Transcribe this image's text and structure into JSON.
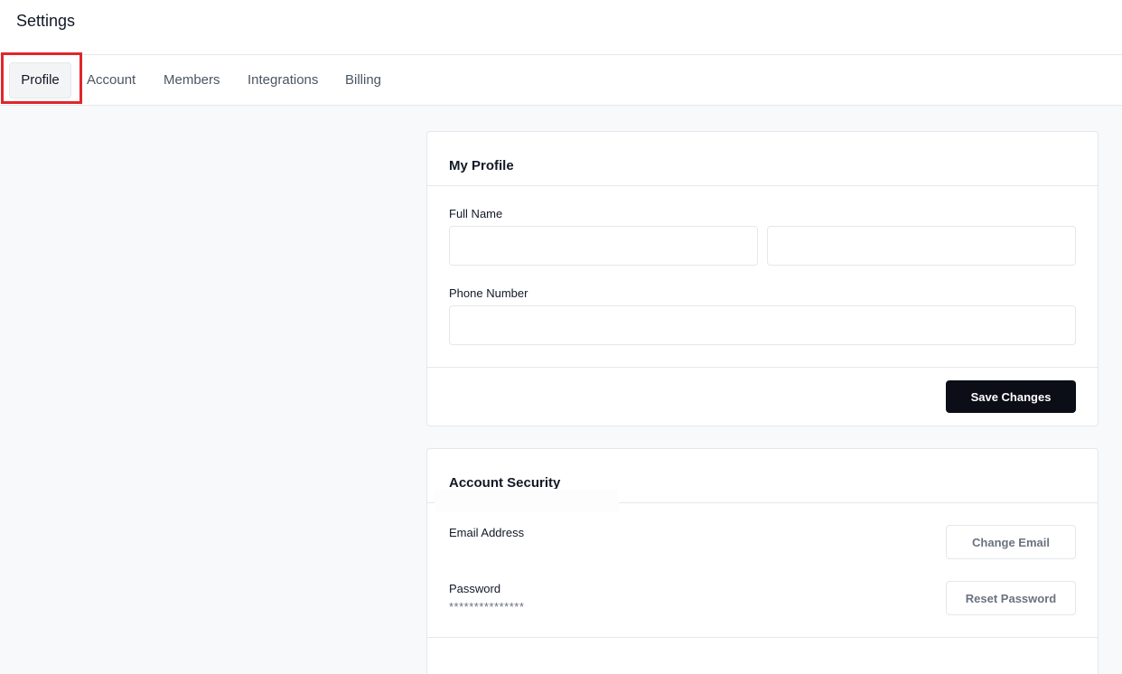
{
  "header": {
    "title": "Settings"
  },
  "tabs": [
    {
      "label": "Profile",
      "active": true
    },
    {
      "label": "Account",
      "active": false
    },
    {
      "label": "Members",
      "active": false
    },
    {
      "label": "Integrations",
      "active": false
    },
    {
      "label": "Billing",
      "active": false
    }
  ],
  "profile": {
    "title": "My Profile",
    "full_name_label": "Full Name",
    "first_name_value": "",
    "last_name_value": "",
    "phone_label": "Phone Number",
    "phone_value": "",
    "save_label": "Save Changes"
  },
  "security": {
    "title": "Account Security",
    "email_label": "Email Address",
    "email_value": "",
    "change_email_label": "Change Email",
    "password_label": "Password",
    "password_value": "***************",
    "reset_password_label": "Reset Password"
  },
  "colors": {
    "accent": "#0b0d17",
    "highlight": "#e0262b",
    "background": "#f8f9fb"
  }
}
